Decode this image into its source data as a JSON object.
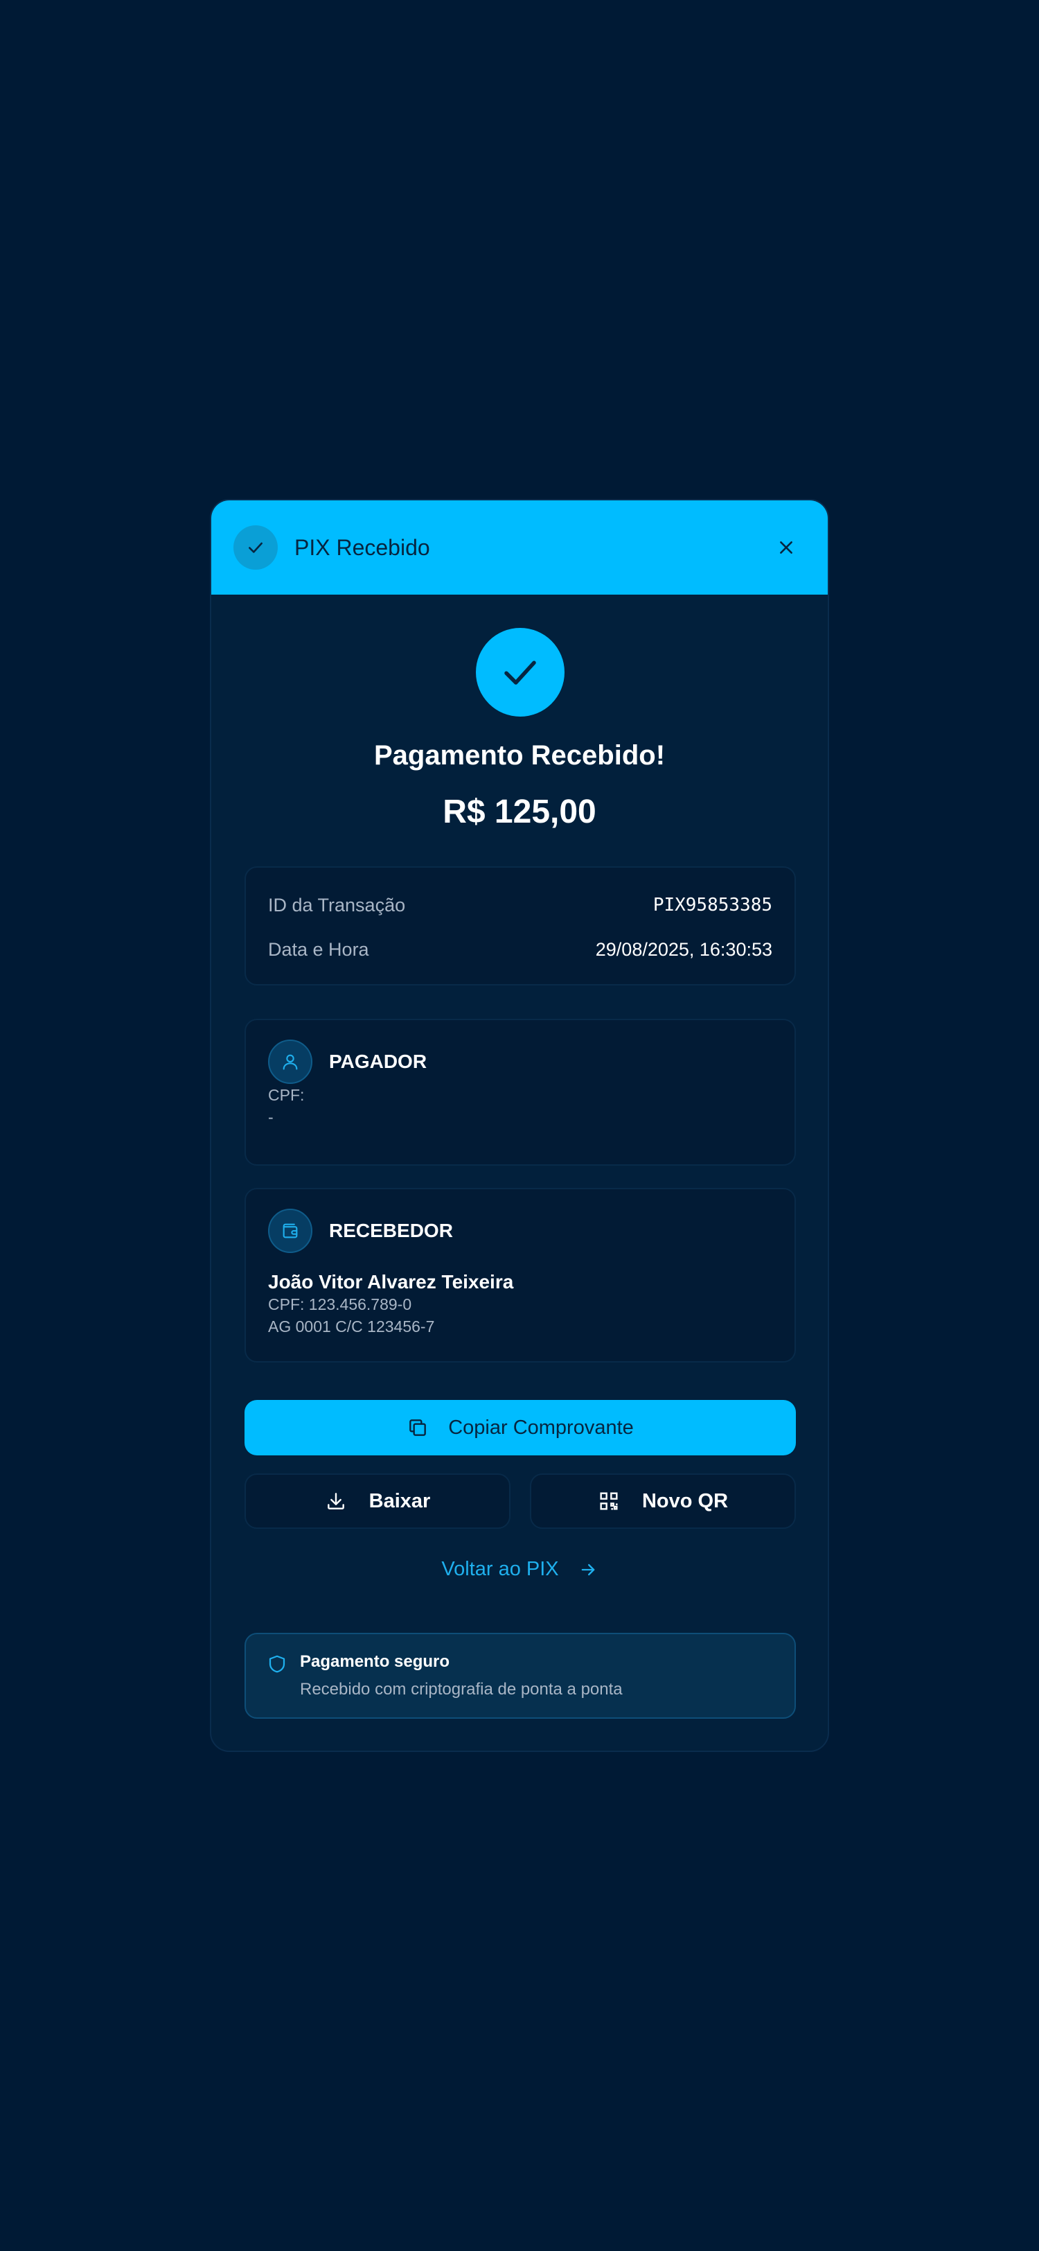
{
  "header": {
    "title": "PIX Recebido",
    "close_icon": "close-icon",
    "check_icon": "check-icon"
  },
  "status": {
    "title": "Pagamento Recebido!",
    "amount": "R$ 125,00"
  },
  "transaction": {
    "id_label": "ID da Transação",
    "id_value": "PIX95853385",
    "date_label": "Data e Hora",
    "date_value": "29/08/2025, 16:30:53"
  },
  "payer": {
    "title": "PAGADOR",
    "cpf": "CPF:",
    "extra": "-",
    "icon": "user-icon"
  },
  "receiver": {
    "title": "RECEBEDOR",
    "name": "João Vitor Alvarez Teixeira",
    "cpf": "CPF: 123.456.789-0",
    "account": "AG 0001 C/C 123456-7",
    "icon": "wallet-icon"
  },
  "actions": {
    "copy_label": "Copiar Comprovante",
    "download_label": "Baixar",
    "new_qr_label": "Novo QR",
    "back_label": "Voltar ao PIX"
  },
  "secure": {
    "title": "Pagamento seguro",
    "subtitle": "Recebido com criptografia de ponta a ponta"
  },
  "colors": {
    "background": "#001a35",
    "card": "#02203c",
    "accent": "#00bcff",
    "link": "#1fb0ee"
  }
}
